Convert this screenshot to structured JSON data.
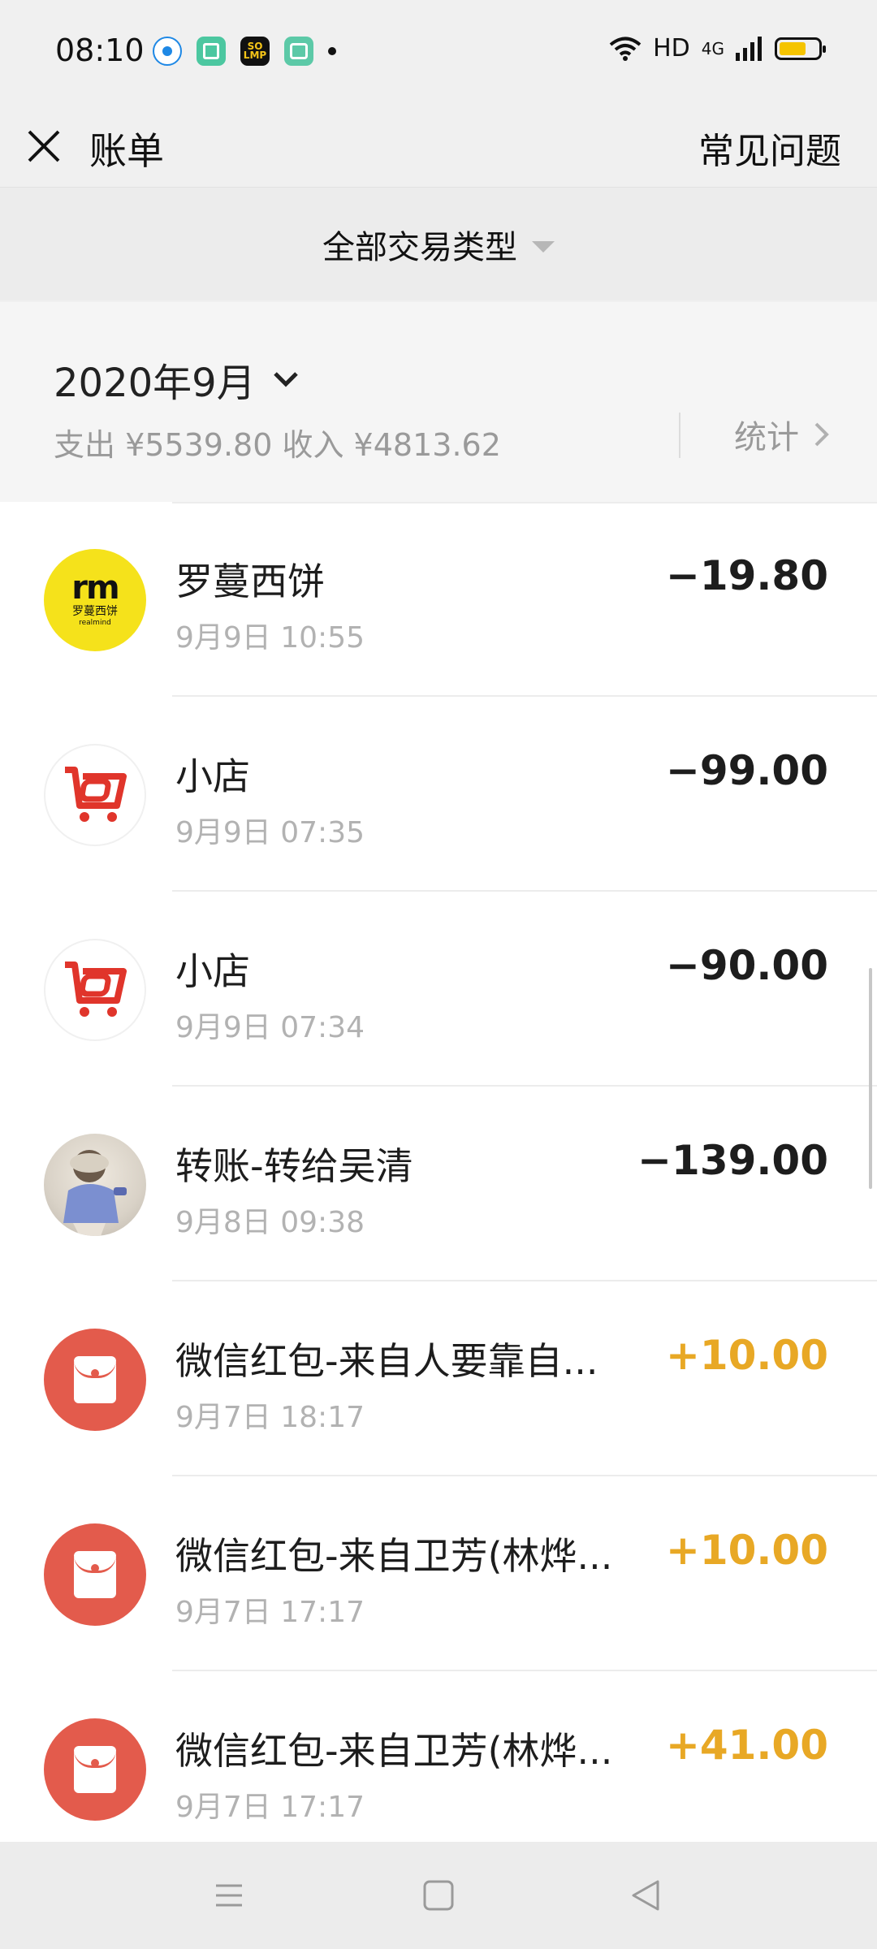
{
  "status_bar": {
    "time": "08:10",
    "hd": "HD",
    "network": "4G",
    "so_icon_text": "SO LMP",
    "battery_level_percent": 70,
    "icons": [
      "browser-icon",
      "app-store-icon",
      "soul-app-icon",
      "chat-app-icon",
      "notification-dot",
      "wifi-icon",
      "signal-icon",
      "battery-icon"
    ]
  },
  "header": {
    "title": "账单",
    "faq_label": "常见问题"
  },
  "filter": {
    "label": "全部交易类型"
  },
  "summary": {
    "month": "2020年9月",
    "totals": "支出 ¥5539.80 收入 ¥4813.62",
    "stats_label": "统计"
  },
  "transactions": [
    {
      "name": "罗蔓西饼",
      "time": "9月9日 10:55",
      "amount": "−19.80",
      "type": "expense",
      "avatar": "luoman-logo",
      "logo_text": "rm",
      "logo_sub": "罗蔓西饼",
      "logo_sub2": "realmind"
    },
    {
      "name": "小店",
      "time": "9月9日 07:35",
      "amount": "−99.00",
      "type": "expense",
      "avatar": "shop-cart-logo"
    },
    {
      "name": "小店",
      "time": "9月9日 07:34",
      "amount": "−90.00",
      "type": "expense",
      "avatar": "shop-cart-logo"
    },
    {
      "name": "转账-转给吴清",
      "time": "9月8日 09:38",
      "amount": "−139.00",
      "type": "expense",
      "avatar": "user-photo"
    },
    {
      "name": "微信红包-来自人要靠自...",
      "time": "9月7日 18:17",
      "amount": "+10.00",
      "type": "income",
      "avatar": "red-packet-icon"
    },
    {
      "name": "微信红包-来自卫芳(林烨...",
      "time": "9月7日 17:17",
      "amount": "+10.00",
      "type": "income",
      "avatar": "red-packet-icon"
    },
    {
      "name": "微信红包-来自卫芳(林烨...",
      "time": "9月7日 17:17",
      "amount": "+41.00",
      "type": "income",
      "avatar": "red-packet-icon"
    }
  ],
  "colors": {
    "income": "#e8a825",
    "red_packet": "#e35b4c",
    "logo_yellow": "#f5e21b",
    "shop_red": "#e0352b"
  },
  "nav_bar": {
    "icons": [
      "menu-icon",
      "home-icon",
      "back-icon"
    ]
  }
}
